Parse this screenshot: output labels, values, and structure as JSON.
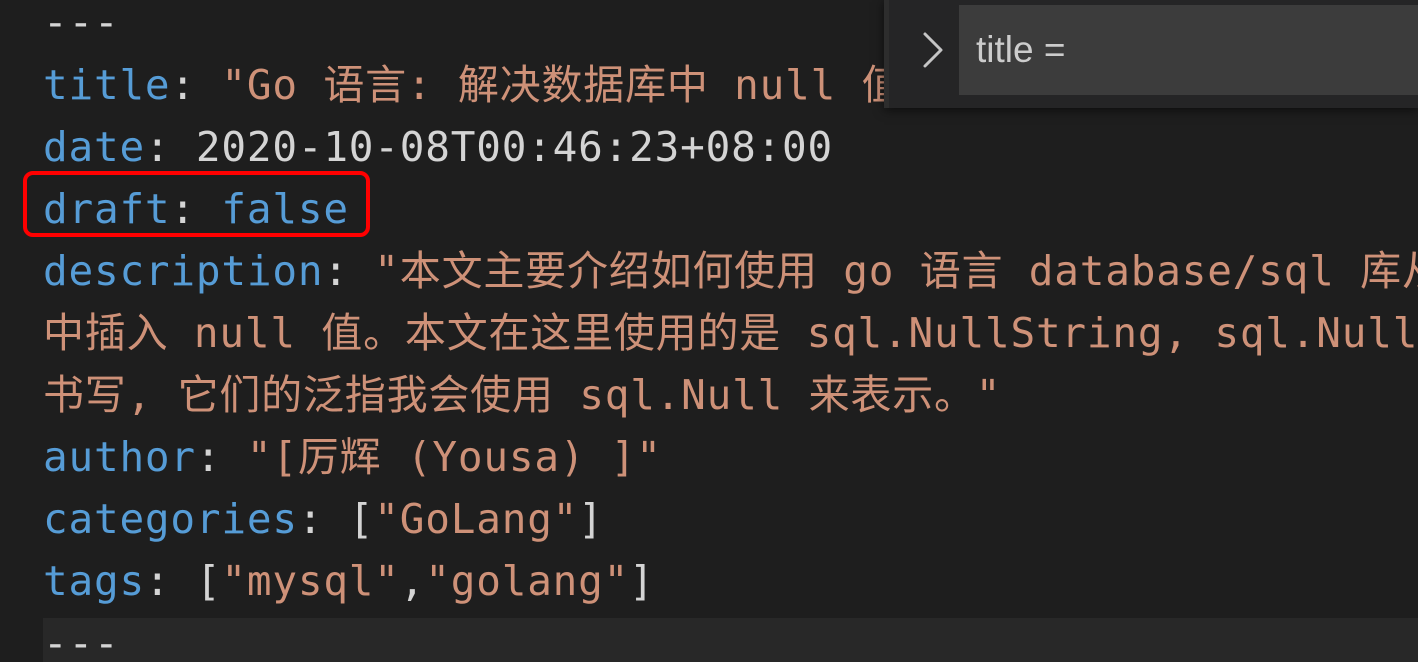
{
  "editor": {
    "lines": [
      {
        "id": "sep_top",
        "parts": [
          {
            "cls": "plain",
            "text": "---"
          }
        ]
      },
      {
        "id": "title",
        "parts": [
          {
            "cls": "key",
            "text": "title"
          },
          {
            "cls": "plain",
            "text": ": "
          },
          {
            "cls": "str",
            "text": "\"Go 语言: 解决数据库中 null 值"
          }
        ]
      },
      {
        "id": "date",
        "parts": [
          {
            "cls": "key",
            "text": "date"
          },
          {
            "cls": "plain",
            "text": ": 2020-10-08T00:46:23+08:00"
          }
        ]
      },
      {
        "id": "draft",
        "parts": [
          {
            "cls": "key",
            "text": "draft"
          },
          {
            "cls": "plain",
            "text": ": "
          },
          {
            "cls": "kw",
            "text": "false"
          }
        ]
      },
      {
        "id": "description",
        "parts": [
          {
            "cls": "key",
            "text": "description"
          },
          {
            "cls": "plain",
            "text": ": "
          },
          {
            "cls": "str",
            "text": "\"本文主要介绍如何使用 go 语言 database/sql 库从"
          }
        ]
      },
      {
        "id": "description_2",
        "parts": [
          {
            "cls": "str",
            "text": "中插入 null 值。本文在这里使用的是 sql.NullString, sql.NullI"
          }
        ]
      },
      {
        "id": "description_3",
        "parts": [
          {
            "cls": "str",
            "text": "书写, 它们的泛指我会使用 sql.Null 来表示。\""
          }
        ]
      },
      {
        "id": "author",
        "parts": [
          {
            "cls": "key",
            "text": "author"
          },
          {
            "cls": "plain",
            "text": ": "
          },
          {
            "cls": "str",
            "text": "\"[厉辉 (Yousa) ]\""
          }
        ]
      },
      {
        "id": "categories",
        "parts": [
          {
            "cls": "key",
            "text": "categories"
          },
          {
            "cls": "plain",
            "text": ": ["
          },
          {
            "cls": "str",
            "text": "\"GoLang\""
          },
          {
            "cls": "plain",
            "text": "]"
          }
        ]
      },
      {
        "id": "tags",
        "parts": [
          {
            "cls": "key",
            "text": "tags"
          },
          {
            "cls": "plain",
            "text": ": ["
          },
          {
            "cls": "str",
            "text": "\"mysql\""
          },
          {
            "cls": "plain",
            "text": ","
          },
          {
            "cls": "str",
            "text": "\"golang\""
          },
          {
            "cls": "plain",
            "text": "]"
          }
        ]
      },
      {
        "id": "sep_bottom",
        "parts": [
          {
            "cls": "plain",
            "text": "---"
          }
        ]
      }
    ]
  },
  "find_widget": {
    "query": "title =",
    "toggle_icon": "chevron-right-icon"
  },
  "colors": {
    "background": "#1e1e1e",
    "key": "#569cd6",
    "string": "#ce9178",
    "plain": "#d4d4d4",
    "highlight_border": "#ff0000",
    "widget_background": "#252526",
    "input_background": "#3c3c3c"
  }
}
